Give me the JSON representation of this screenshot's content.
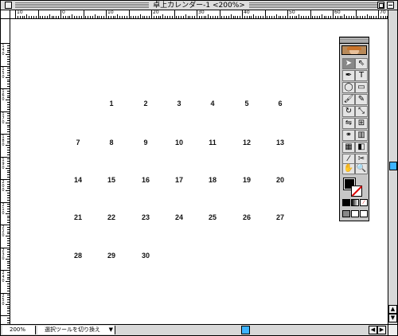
{
  "window": {
    "title": "卓上カレンダー-1 <200%>",
    "zoom_label": "200%",
    "status_text": "選択ツールを切り換え"
  },
  "ruler": {
    "h_labels": [
      "10",
      "0",
      "10",
      "20",
      "30",
      "40",
      "50",
      "60",
      "70",
      "80",
      "90",
      "100",
      "110"
    ],
    "v_labels": [
      "1\n4\n0",
      "1\n5\n0",
      "1\n6\n0",
      "1\n7\n0",
      "1\n8\n0",
      "1\n9\n0",
      "2\n0\n0",
      "2\n1\n0",
      "2\n2\n0",
      "2\n3\n0",
      "2\n4\n0",
      "2\n5\n0",
      "2\n6\n0"
    ]
  },
  "calendar": {
    "weeks": [
      [
        "",
        "1",
        "2",
        "3",
        "4",
        "5",
        "6"
      ],
      [
        "7",
        "8",
        "9",
        "10",
        "11",
        "12",
        "13"
      ],
      [
        "14",
        "15",
        "16",
        "17",
        "18",
        "19",
        "20"
      ],
      [
        "21",
        "22",
        "23",
        "24",
        "25",
        "26",
        "27"
      ],
      [
        "28",
        "29",
        "30",
        "",
        "",
        "",
        ""
      ]
    ]
  },
  "toolbox": {
    "tools": [
      {
        "name": "selection-tool-icon",
        "glyph": "➤"
      },
      {
        "name": "direct-selection-tool-icon",
        "glyph": "⇖"
      },
      {
        "name": "pen-tool-icon",
        "glyph": "✒"
      },
      {
        "name": "type-tool-icon",
        "glyph": "T"
      },
      {
        "name": "ellipse-tool-icon",
        "glyph": "◯"
      },
      {
        "name": "rectangle-tool-icon",
        "glyph": "▭"
      },
      {
        "name": "brush-tool-icon",
        "glyph": "🖌"
      },
      {
        "name": "pencil-tool-icon",
        "glyph": "✎"
      },
      {
        "name": "rotate-tool-icon",
        "glyph": "↻"
      },
      {
        "name": "scale-tool-icon",
        "glyph": "⤡"
      },
      {
        "name": "reflect-tool-icon",
        "glyph": "⇋"
      },
      {
        "name": "free-transform-tool-icon",
        "glyph": "⊞"
      },
      {
        "name": "blend-tool-icon",
        "glyph": "⚭"
      },
      {
        "name": "graph-tool-icon",
        "glyph": "▥"
      },
      {
        "name": "mesh-tool-icon",
        "glyph": "▦"
      },
      {
        "name": "gradient-tool-icon",
        "glyph": "◧"
      },
      {
        "name": "eyedropper-tool-icon",
        "glyph": "⁄"
      },
      {
        "name": "scissors-tool-icon",
        "glyph": "✂"
      },
      {
        "name": "hand-tool-icon",
        "glyph": "✋"
      },
      {
        "name": "zoom-tool-icon",
        "glyph": "🔍"
      }
    ],
    "colors": {
      "fill": "#000000",
      "stroke_none": "#dd0000",
      "scroll_thumb": "#3db3ff"
    }
  }
}
